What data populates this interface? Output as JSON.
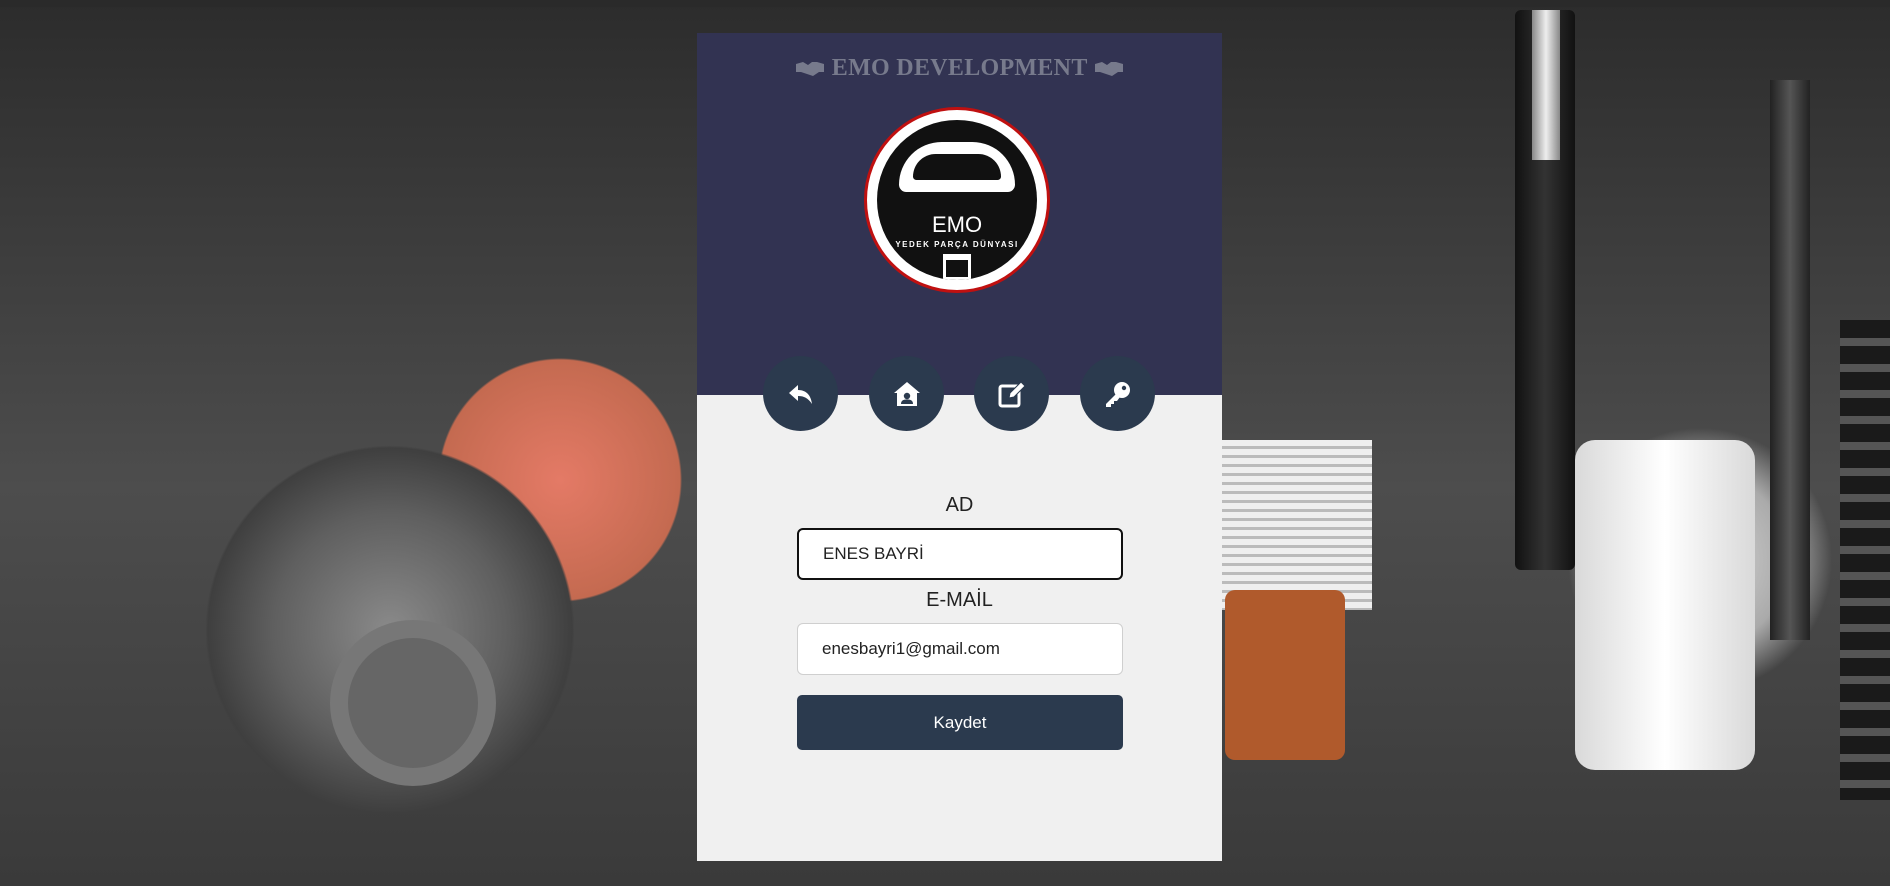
{
  "header": {
    "brand_title": "EMO DEVELOPMENT",
    "brand_icon": "handshake-icon"
  },
  "logo": {
    "name": "EMO",
    "subtitle": "YEDEK PARÇA DÜNYASI"
  },
  "nav": {
    "buttons": [
      {
        "icon": "reply-icon"
      },
      {
        "icon": "house-user-icon"
      },
      {
        "icon": "edit-icon"
      },
      {
        "icon": "key-icon"
      }
    ]
  },
  "form": {
    "name_label": "AD",
    "name_value": "ENES BAYRİ",
    "email_label": "E-MAİL",
    "email_value": "enesbayri1@gmail.com",
    "save_label": "Kaydet"
  },
  "colors": {
    "header_bg": "#323352",
    "button_bg": "#2b3a4e",
    "logo_ring": "#c01010",
    "card_bg": "#f0f0f0"
  }
}
